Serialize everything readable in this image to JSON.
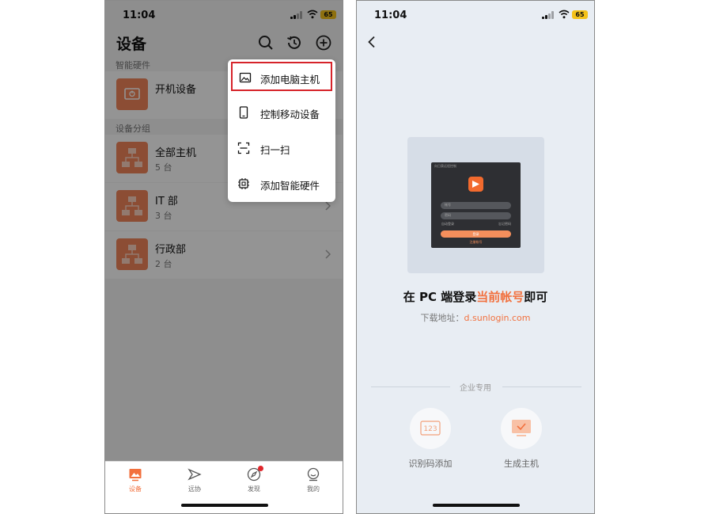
{
  "phone_left": {
    "status": {
      "time": "11:04",
      "battery": "65"
    },
    "header": {
      "title": "设备"
    },
    "sections": {
      "smart_hardware": "智能硬件",
      "device_groups": "设备分组"
    },
    "power_device": {
      "name": "开机设备"
    },
    "groups": [
      {
        "name": "全部主机",
        "count": "5 台"
      },
      {
        "name": "IT 部",
        "count": "3 台"
      },
      {
        "name": "行政部",
        "count": "2 台"
      }
    ],
    "menu": [
      {
        "label": "添加电脑主机",
        "icon": "image-icon",
        "highlighted": true
      },
      {
        "label": "控制移动设备",
        "icon": "phone-icon"
      },
      {
        "label": "扫一扫",
        "icon": "scan-icon"
      },
      {
        "label": "添加智能硬件",
        "icon": "chip-icon"
      }
    ],
    "tabs": [
      {
        "label": "设备",
        "active": true
      },
      {
        "label": "远协"
      },
      {
        "label": "发现",
        "badge": true
      },
      {
        "label": "我的"
      }
    ],
    "colors": {
      "accent": "#f2703d",
      "highlight_border": "#d6232a"
    }
  },
  "phone_right": {
    "status": {
      "time": "11:04",
      "battery": "65"
    },
    "preview_window": {
      "title": "向日葵远程控制",
      "account_placeholder": "帐号",
      "password_placeholder": "密码",
      "auto_login": "自动登录",
      "remember_password": "忘记密码",
      "login_button": "登录",
      "register_link": "注册帐号"
    },
    "headline": {
      "prefix": "在 PC 端登录",
      "highlight": "当前帐号",
      "suffix": "即可"
    },
    "download": {
      "label": "下载地址：",
      "url": "d.sunlogin.com"
    },
    "enterprise": {
      "label": "企业专用",
      "options": [
        {
          "label": "识别码添加",
          "icon_text": "123"
        },
        {
          "label": "生成主机"
        }
      ]
    }
  }
}
